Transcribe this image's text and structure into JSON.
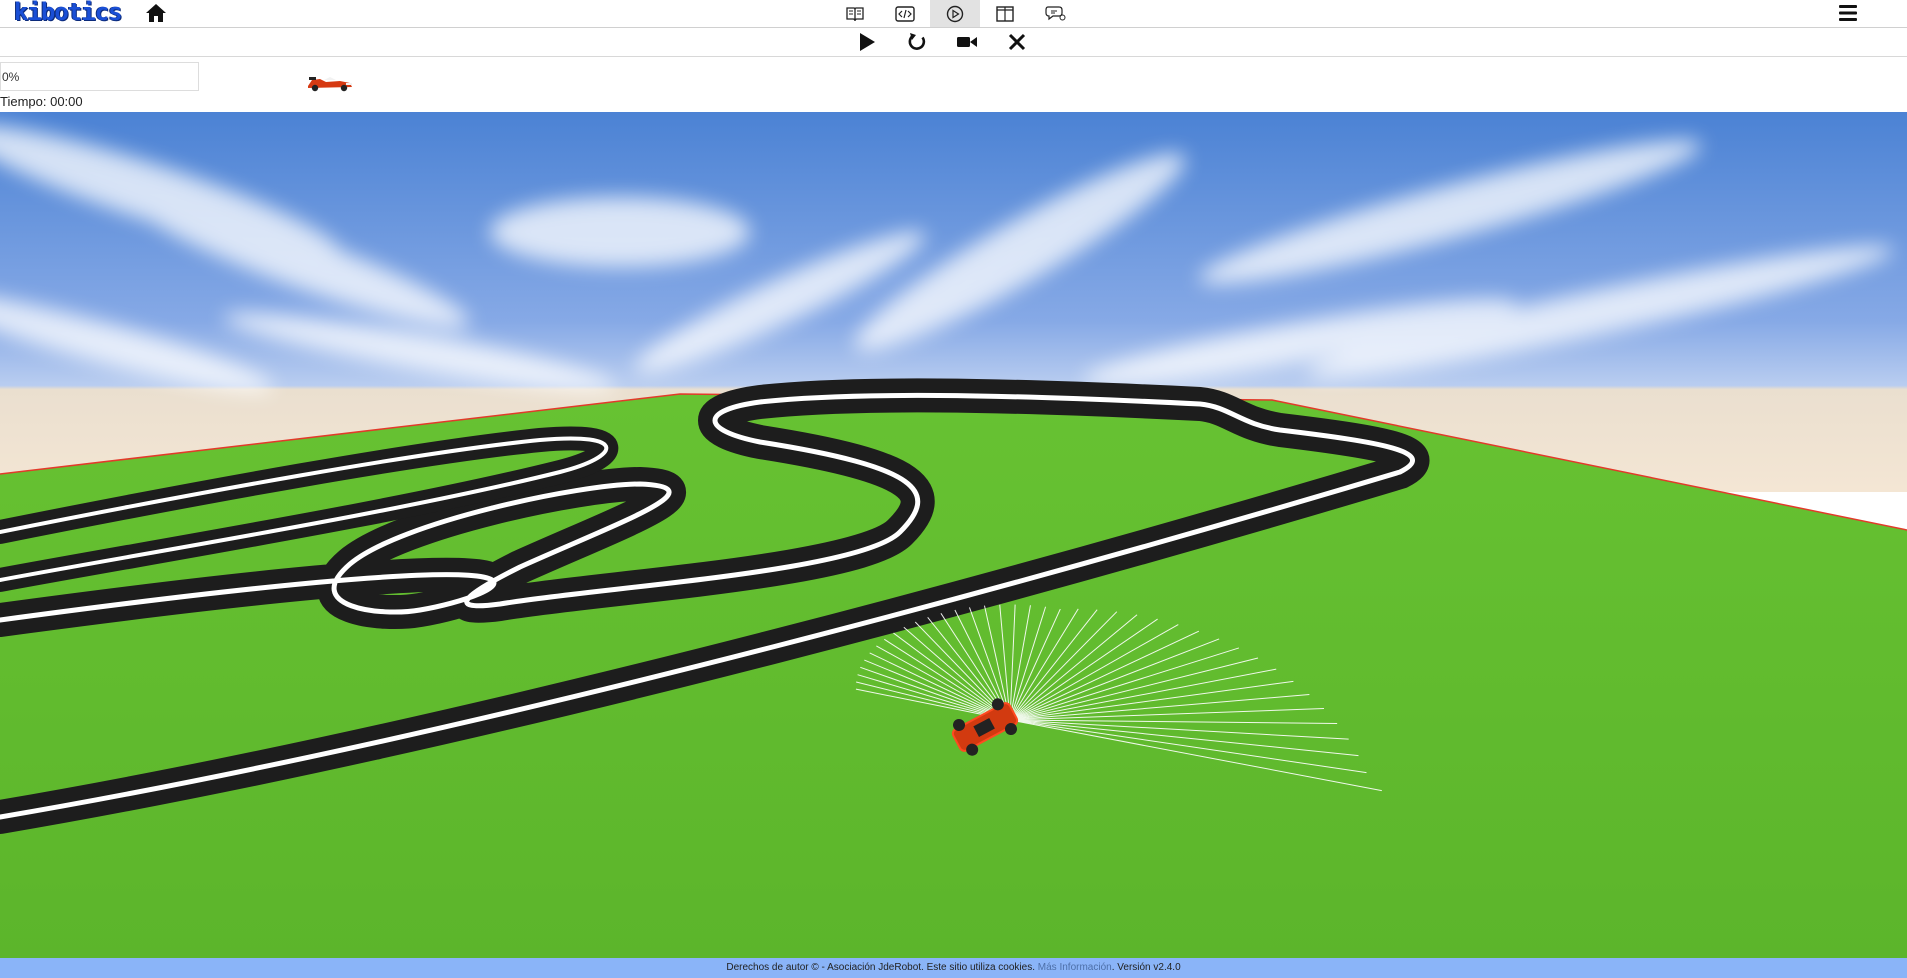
{
  "header": {
    "logo_text": "kibotics",
    "home_icon": "home-icon",
    "view_tabs": [
      {
        "name": "book-icon",
        "active": false
      },
      {
        "name": "code-icon",
        "active": false
      },
      {
        "name": "play-circle-icon",
        "active": true
      },
      {
        "name": "split-view-icon",
        "active": false
      },
      {
        "name": "chat-icon",
        "active": false
      }
    ],
    "menu_icon": "hamburger-menu-icon"
  },
  "controls": {
    "items": [
      "play-icon",
      "reset-icon",
      "camera-icon",
      "close-icon"
    ]
  },
  "status": {
    "progress_label": "0%",
    "progress_fraction": 0.0,
    "progress_color": "#ffad00",
    "time_label": "Tiempo: 00:00"
  },
  "footer": {
    "text_before": "Derechos de autor © - Asociación JdeRobot. Este sitio utiliza cookies. ",
    "link_text": "Más Información",
    "text_after": ". Versión v2.4.0"
  },
  "colors": {
    "sky": "#5b8fd8",
    "ground": "#6ac236",
    "track": "#1c1c1c",
    "accent": "#ffad00",
    "footer": "#8ab4f8"
  }
}
